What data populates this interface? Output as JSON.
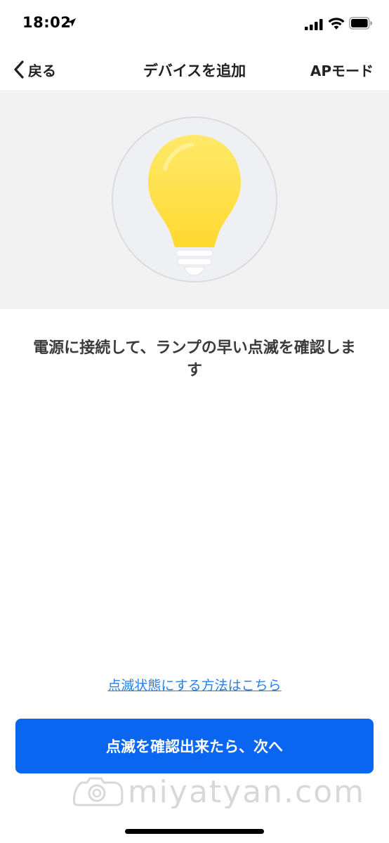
{
  "status_bar": {
    "time": "18:02",
    "icons": [
      "location-arrow-icon",
      "signal-bars-icon",
      "wifi-icon",
      "battery-icon"
    ]
  },
  "nav": {
    "back_label": "戻る",
    "title": "デバイスを追加",
    "right_action": "APモード"
  },
  "hero": {
    "icon": "light-bulb-icon",
    "bulb_color": "#FFE24A"
  },
  "instruction": "電源に接続して、ランプの早い点滅を確認します",
  "help_link": "点滅状態にする方法はこちら",
  "primary_button": "点滅を確認出来たら、次へ",
  "watermark": "miyatyan.com",
  "colors": {
    "accent": "#0A66F0",
    "link": "#2A7EE8",
    "hero_background": "#F2F2F2"
  }
}
